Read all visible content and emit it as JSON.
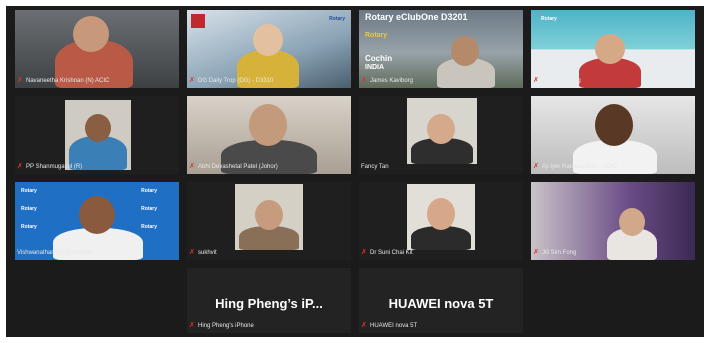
{
  "participants": [
    {
      "name": "Navaneetha Krishnan (N) ACIC",
      "muted": true
    },
    {
      "name": "DG Daily Trop (DG) - D3310",
      "muted": true
    },
    {
      "name": "James Kaviborg",
      "muted": true
    },
    {
      "name": "Angeline Fong",
      "muted": true
    },
    {
      "name": "PP Shanmugavel (R)",
      "muted": true
    },
    {
      "name": "Abhi Devashetal Patel (Johor)",
      "muted": true
    },
    {
      "name": "Fancy Tan",
      "muted": false
    },
    {
      "name": "Aji Iyer Ranganathan - ACIC",
      "muted": true
    },
    {
      "name": "Vishwanathan Vaidyanathan",
      "muted": false
    },
    {
      "name": "sukhvit",
      "muted": true
    },
    {
      "name": "Dr Suni Chai Kit",
      "muted": true
    },
    {
      "name": "Jill Sim Fong",
      "muted": true
    },
    {
      "name": "Hing Pheng's iPhone",
      "muted": true,
      "display": "Hing Pheng’s iP..."
    },
    {
      "name": "HUAWEI nova 5T",
      "muted": true,
      "display": "HUAWEI nova 5T"
    }
  ],
  "banner": {
    "title": "Rotary eClubOne D3201",
    "brand": "Rotary",
    "city": "Cochin",
    "country": "INDIA"
  },
  "logos": {
    "rotary": "Rotary"
  },
  "colors": {
    "active_border": "#d8df3a",
    "muted_icon": "#e03030",
    "background": "#1b1b1b"
  }
}
